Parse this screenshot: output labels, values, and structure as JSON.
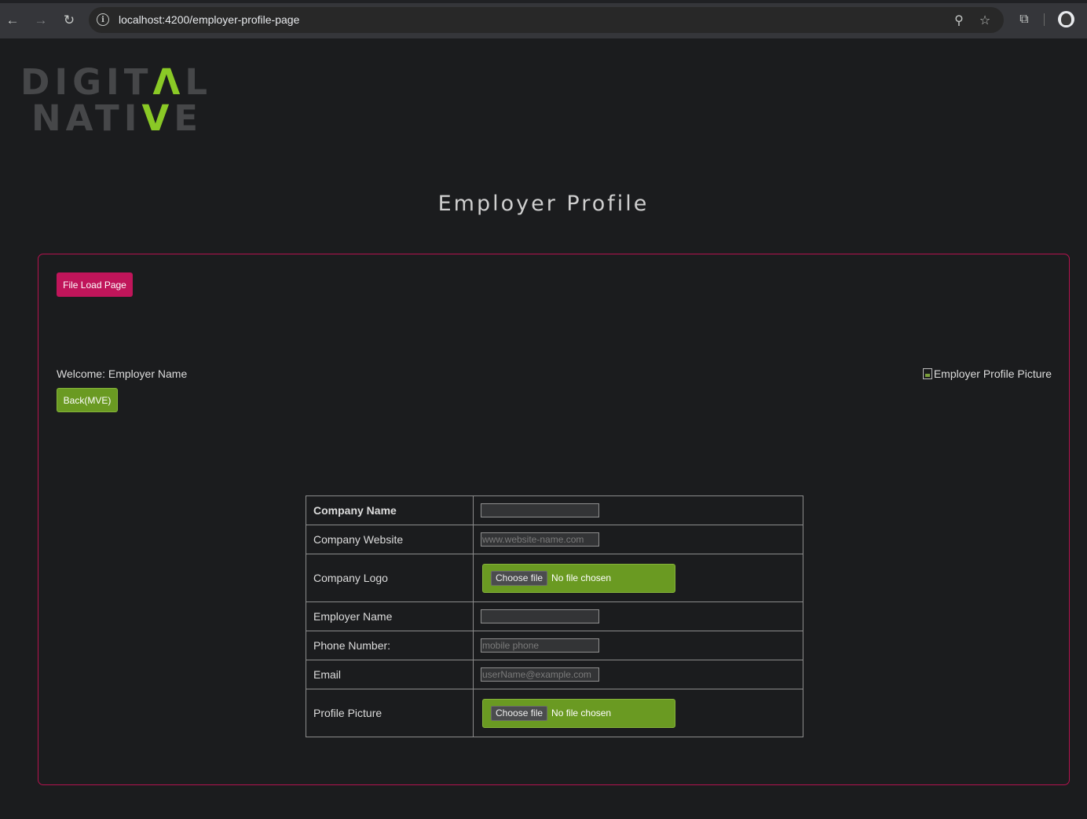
{
  "browser": {
    "url": "localhost:4200/employer-profile-page"
  },
  "logo": {
    "line1_pre": "DIGIT",
    "line1_accent": "Λ",
    "line1_post": "L",
    "line2_pre": "NATI",
    "line2_accent": "V",
    "line2_post": "E"
  },
  "page": {
    "title": "Employer Profile",
    "file_load_button": "File Load Page",
    "welcome": "Welcome: Employer Name",
    "back_button": "Back(MVE)",
    "profile_picture_alt": "Employer Profile Picture"
  },
  "form": {
    "rows": [
      {
        "label": "Company Name",
        "type": "text",
        "placeholder": ""
      },
      {
        "label": "Company Website",
        "type": "text",
        "placeholder": "www.website-name.com"
      },
      {
        "label": "Company Logo",
        "type": "file",
        "button": "Choose file",
        "status": "No file chosen"
      },
      {
        "label": "Employer Name",
        "type": "text",
        "placeholder": ""
      },
      {
        "label": "Phone Number:",
        "type": "text",
        "placeholder": "mobile phone"
      },
      {
        "label": "Email",
        "type": "text",
        "placeholder": "userName@example.com"
      },
      {
        "label": "Profile Picture",
        "type": "file",
        "button": "Choose file",
        "status": "No file chosen"
      }
    ]
  },
  "colors": {
    "accent_green": "#8ac926",
    "button_pink": "#c0155a",
    "panel_border": "#b5134f"
  }
}
